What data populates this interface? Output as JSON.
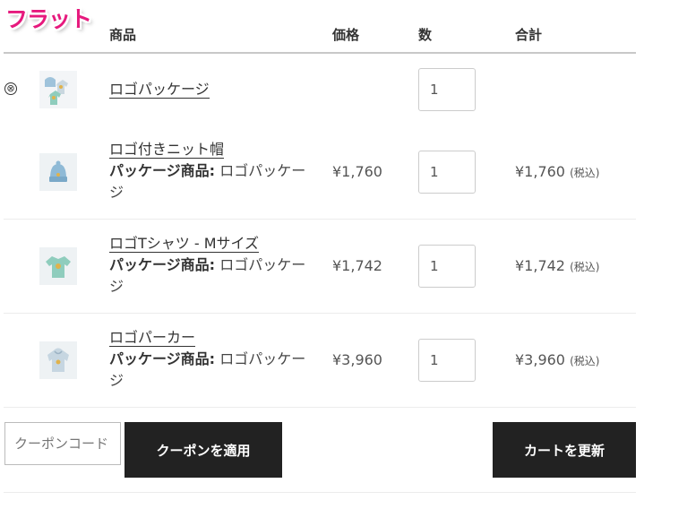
{
  "badge": "フラット",
  "table": {
    "headers": {
      "product": "商品",
      "price": "価格",
      "quantity": "数",
      "total": "合計"
    }
  },
  "rows": [
    {
      "name": "ロゴパッケージ",
      "meta_label": "",
      "meta_value": "",
      "price": "",
      "quantity": "1",
      "total": "",
      "total_note": ""
    },
    {
      "name": "ロゴ付きニット帽",
      "meta_label": "パッケージ商品:",
      "meta_value": "ロゴパッケージ",
      "price": "¥1,760",
      "quantity": "1",
      "total": "¥1,760",
      "total_note": "(税込)"
    },
    {
      "name": "ロゴTシャツ - Mサイズ",
      "meta_label": "パッケージ商品:",
      "meta_value": "ロゴパッケージ",
      "price": "¥1,742",
      "quantity": "1",
      "total": "¥1,742",
      "total_note": "(税込)"
    },
    {
      "name": "ロゴパーカー",
      "meta_label": "パッケージ商品:",
      "meta_value": "ロゴパッケージ",
      "price": "¥3,960",
      "quantity": "1",
      "total": "¥3,960",
      "total_note": "(税込)"
    }
  ],
  "actions": {
    "remove_symbol": "⊗",
    "coupon_placeholder": "クーポンコード",
    "apply_coupon": "クーポンを適用",
    "update_cart": "カートを更新"
  },
  "thumbnails": [
    "package-thumbnail",
    "knit-hat-thumbnail",
    "tshirt-thumbnail",
    "hoodie-thumbnail"
  ]
}
